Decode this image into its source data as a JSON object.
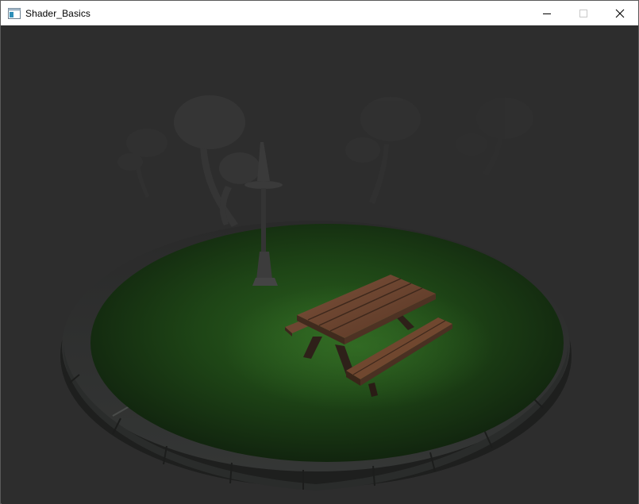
{
  "window": {
    "title": "Shader_Basics",
    "icon": "app-window-icon"
  },
  "controls": {
    "minimize_icon": "minimize-icon",
    "maximize_icon": "maximize-icon",
    "close_icon": "close-icon"
  },
  "scene": {
    "background_color": "#2d2d2d",
    "grass_color": "#1f4a16",
    "stone_color": "#2f302f",
    "wood_color": "#6b4430"
  }
}
